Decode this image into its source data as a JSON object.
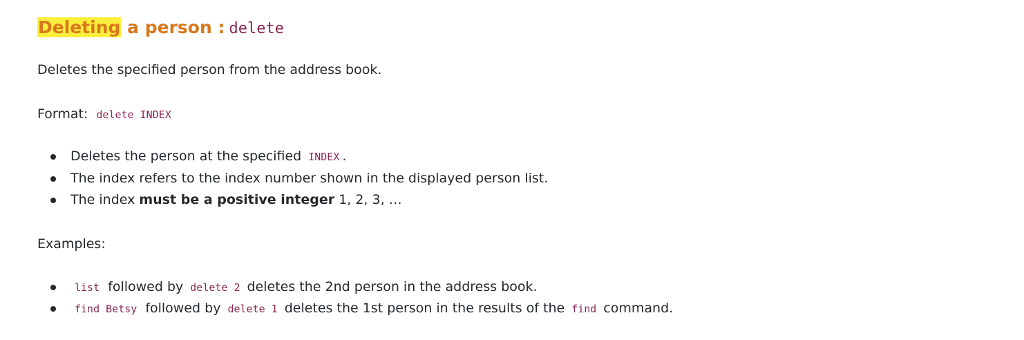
{
  "heading": {
    "highlighted": "Deleting",
    "rest": " a person :",
    "command": "delete"
  },
  "description": "Deletes the specified person from the address book.",
  "format": {
    "label": "Format:",
    "code": "delete INDEX"
  },
  "rules": {
    "item1_text": "Deletes the person at the specified",
    "item1_code": "INDEX",
    "item1_suffix": ".",
    "item2_text": "The index refers to the index number shown in the displayed person list.",
    "item3_prefix": "The index ",
    "item3_bold": "must be a positive integer",
    "item3_suffix": " 1, 2, 3, …"
  },
  "examples": {
    "label": "Examples:",
    "ex1_code1": "list",
    "ex1_text1": "followed by",
    "ex1_code2": "delete 2",
    "ex1_text2": "deletes the 2nd person in the address book.",
    "ex2_code1": "find Betsy",
    "ex2_text1": "followed by",
    "ex2_code2": "delete 1",
    "ex2_text2": "deletes the 1st person in the results of the",
    "ex2_code3": "find",
    "ex2_text3": "command."
  }
}
